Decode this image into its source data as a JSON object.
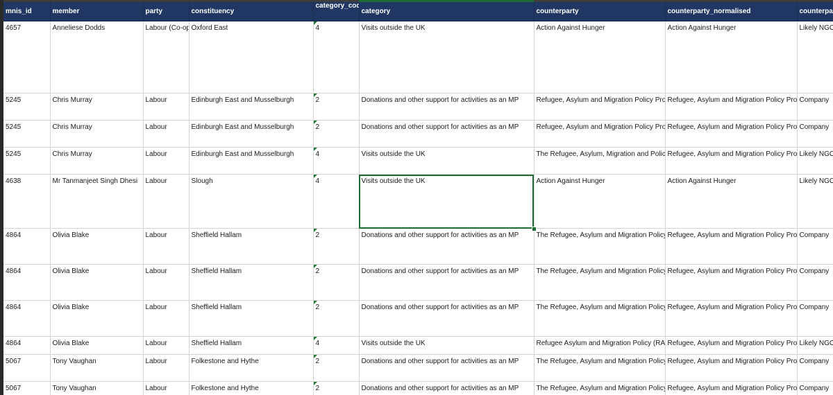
{
  "headers": {
    "mnis_id": "mnis_id",
    "member": "member",
    "party": "party",
    "constituency": "constituency",
    "category_code": "category_code",
    "category": "category",
    "counterparty": "counterparty",
    "counterparty_normalised": "counterparty_normalised",
    "counterparty_type": "counterpart"
  },
  "rows": [
    {
      "mnis_id": "4657",
      "member": "Anneliese Dodds",
      "party": "Labour (Co-op)",
      "constituency": "Oxford East",
      "category_code": "4",
      "category": "Visits outside the UK",
      "counterparty": "Action Against Hunger",
      "counterparty_normalised": "Action Against Hunger",
      "counterparty_type": "Likely NGO"
    },
    {
      "mnis_id": "5245",
      "member": "Chris Murray",
      "party": "Labour",
      "constituency": "Edinburgh East and Musselburgh",
      "category_code": "2",
      "category": "Donations and other support for activities as an MP",
      "counterparty": "Refugee, Asylum and Migration Policy Proje",
      "counterparty_normalised": "Refugee, Asylum and Migration Policy Proje",
      "counterparty_type": "Company"
    },
    {
      "mnis_id": "5245",
      "member": "Chris Murray",
      "party": "Labour",
      "constituency": "Edinburgh East and Musselburgh",
      "category_code": "2",
      "category": "Donations and other support for activities as an MP",
      "counterparty": "Refugee, Asylum and Migration Policy Proje",
      "counterparty_normalised": "Refugee, Asylum and Migration Policy Proje",
      "counterparty_type": "Company"
    },
    {
      "mnis_id": "5245",
      "member": "Chris Murray",
      "party": "Labour",
      "constituency": "Edinburgh East and Musselburgh",
      "category_code": "4",
      "category": "Visits outside the UK",
      "counterparty": "The Refugee, Asylum, Migration and Policy",
      "counterparty_normalised": "Refugee, Asylum and Migration Policy Proje",
      "counterparty_type": "Likely NGO"
    },
    {
      "mnis_id": "4638",
      "member": "Mr Tanmanjeet Singh Dhesi",
      "party": "Labour",
      "constituency": "Slough",
      "category_code": "4",
      "category": "Visits outside the UK",
      "counterparty": "Action Against Hunger",
      "counterparty_normalised": "Action Against Hunger",
      "counterparty_type": "Likely NGO"
    },
    {
      "mnis_id": "4864",
      "member": "Olivia Blake",
      "party": "Labour",
      "constituency": "Sheffield Hallam",
      "category_code": "2",
      "category": "Donations and other support for activities as an MP",
      "counterparty": "The Refugee, Asylum and Migration Policy I",
      "counterparty_normalised": "Refugee, Asylum and Migration Policy Proje",
      "counterparty_type": "Company"
    },
    {
      "mnis_id": "4864",
      "member": "Olivia Blake",
      "party": "Labour",
      "constituency": "Sheffield Hallam",
      "category_code": "2",
      "category": "Donations and other support for activities as an MP",
      "counterparty": "The Refugee, Asylum and Migration Policy I",
      "counterparty_normalised": "Refugee, Asylum and Migration Policy Proje",
      "counterparty_type": "Company"
    },
    {
      "mnis_id": "4864",
      "member": "Olivia Blake",
      "party": "Labour",
      "constituency": "Sheffield Hallam",
      "category_code": "2",
      "category": "Donations and other support for activities as an MP",
      "counterparty": "The Refugee, Asylum and Migration Policy I",
      "counterparty_normalised": "Refugee, Asylum and Migration Policy Proje",
      "counterparty_type": "Company"
    },
    {
      "mnis_id": "4864",
      "member": "Olivia Blake",
      "party": "Labour",
      "constituency": "Sheffield Hallam",
      "category_code": "4",
      "category": "Visits outside the UK",
      "counterparty": "Refugee Asylum and Migration Policy (RAM",
      "counterparty_normalised": "Refugee, Asylum and Migration Policy Proje",
      "counterparty_type": "Likely NGO"
    },
    {
      "mnis_id": "5067",
      "member": "Tony Vaughan",
      "party": "Labour",
      "constituency": "Folkestone and Hythe",
      "category_code": "2",
      "category": "Donations and other support for activities as an MP",
      "counterparty": "The Refugee, Asylum and Migration Policy I",
      "counterparty_normalised": "Refugee, Asylum and Migration Policy Proje",
      "counterparty_type": "Company"
    },
    {
      "mnis_id": "5067",
      "member": "Tony Vaughan",
      "party": "Labour",
      "constituency": "Folkestone and Hythe",
      "category_code": "2",
      "category": "Donations and other support for activities as an MP",
      "counterparty": "The Refugee, Asylum and Migration Policy I",
      "counterparty_normalised": "Refugee, Asylum and Migration Policy Proje",
      "counterparty_type": "Company"
    }
  ],
  "selected_cell": {
    "row": 4,
    "column": "category"
  },
  "colors": {
    "header_bg": "#203764",
    "header_text": "#ffffff",
    "selection": "#1e6b34",
    "gridline": "#d4d4d4"
  }
}
